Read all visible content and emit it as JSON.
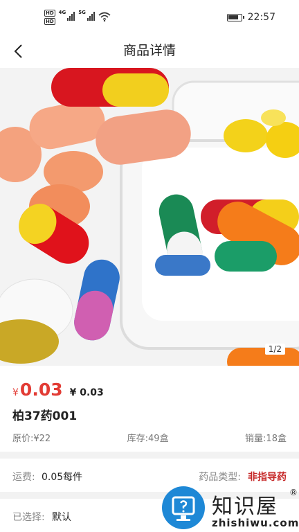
{
  "status_bar": {
    "hd_labels": [
      "HD",
      "HD"
    ],
    "network_labels": [
      "4G",
      "5G"
    ],
    "time": "22:57"
  },
  "header": {
    "title": "商品详情"
  },
  "gallery": {
    "pager": "1/2"
  },
  "product": {
    "currency": "¥",
    "price": "0.03",
    "secondary_price": "¥ 0.03",
    "name": "柏37药001",
    "original_price": "原价:¥22",
    "stock": "库存:49盒",
    "sales": "销量:18盒"
  },
  "shipping": {
    "label": "运费:",
    "value": "0.05每件",
    "type_label": "药品类型:",
    "type_value": "非指导药"
  },
  "selection": {
    "label": "已选择:",
    "value": "默认"
  },
  "watermark": {
    "title": "知识屋",
    "registered": "®",
    "url": "zhishiwu.com"
  },
  "colors": {
    "accent": "#e23c35",
    "type_red": "#c62828",
    "brand_blue": "#1e88d6"
  }
}
